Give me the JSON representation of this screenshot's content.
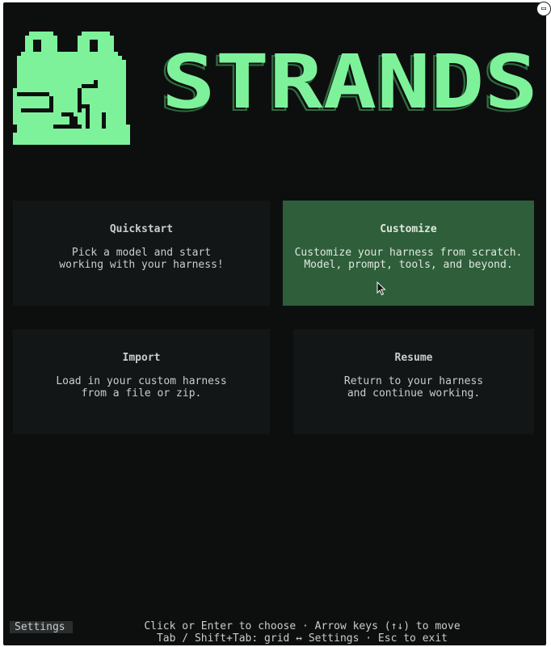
{
  "logo": {
    "text": "STRANDS",
    "color": "#7ef29a"
  },
  "cards": {
    "quickstart": {
      "title": "Quickstart",
      "desc": "Pick a model and start\nworking with your harness!"
    },
    "customize": {
      "title": "Customize",
      "desc": "Customize your harness from scratch.\nModel, prompt, tools, and beyond.",
      "selected": true
    },
    "import": {
      "title": "Import",
      "desc": "Load in your custom harness\nfrom a file or zip."
    },
    "resume": {
      "title": "Resume",
      "desc": "Return to your harness\nand continue working."
    }
  },
  "settings_label": "Settings",
  "footer": {
    "line1": "Click or Enter to choose · Arrow keys (↑↓) to move",
    "line2": "Tab / Shift+Tab: grid ↔ Settings · Esc to exit"
  },
  "colors": {
    "background": "#0d0f0f",
    "card": "#131616",
    "selected": "#2e5f3a",
    "accent": "#7ef29a"
  }
}
